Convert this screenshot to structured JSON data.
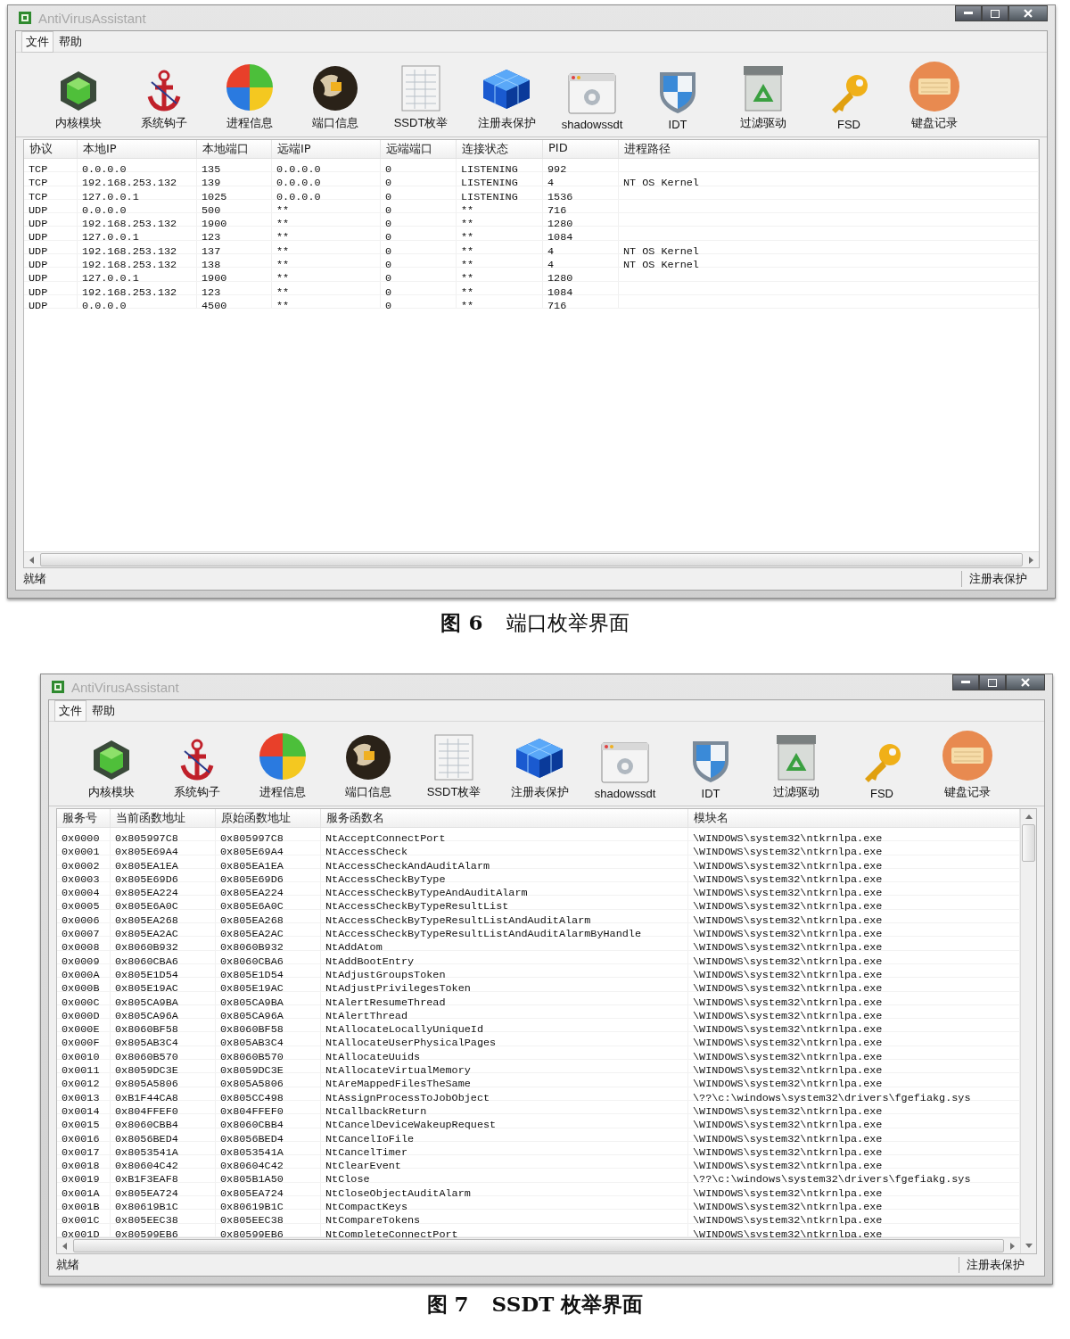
{
  "figures": [
    {
      "window": {
        "title": "AntiVirusAssistant",
        "menu": [
          "文件",
          "帮助"
        ],
        "toolbar": [
          {
            "label": "内核模块"
          },
          {
            "label": "系统钩子"
          },
          {
            "label": "进程信息"
          },
          {
            "label": "端口信息"
          },
          {
            "label": "SSDT枚举"
          },
          {
            "label": "注册表保护"
          },
          {
            "label": "shadowssdt"
          },
          {
            "label": "IDT"
          },
          {
            "label": "过滤驱动"
          },
          {
            "label": "FSD"
          },
          {
            "label": "键盘记录"
          }
        ],
        "table": {
          "vertical_scrollbar": false,
          "columns": [
            "协议",
            "本地IP",
            "本地端口",
            "远端IP",
            "远端端口",
            "连接状态",
            "PID",
            "进程路径"
          ],
          "rows": [
            [
              "TCP",
              "0.0.0.0",
              "135",
              "0.0.0.0",
              "0",
              "LISTENING",
              "992"
            ],
            [
              "TCP",
              "192.168.253.132",
              "139",
              "0.0.0.0",
              "0",
              "LISTENING",
              "4",
              "NT OS Kernel"
            ],
            [
              "TCP",
              "127.0.0.1",
              "1025",
              "0.0.0.0",
              "0",
              "LISTENING",
              "1536"
            ],
            [
              "UDP",
              "0.0.0.0",
              "500",
              "**",
              "0",
              "**",
              "716"
            ],
            [
              "UDP",
              "192.168.253.132",
              "1900",
              "**",
              "0",
              "**",
              "1280"
            ],
            [
              "UDP",
              "127.0.0.1",
              "123",
              "**",
              "0",
              "**",
              "1084"
            ],
            [
              "UDP",
              "192.168.253.132",
              "137",
              "**",
              "0",
              "**",
              "4",
              "NT OS Kernel"
            ],
            [
              "UDP",
              "192.168.253.132",
              "138",
              "**",
              "0",
              "**",
              "4",
              "NT OS Kernel"
            ],
            [
              "UDP",
              "127.0.0.1",
              "1900",
              "**",
              "0",
              "**",
              "1280"
            ],
            [
              "UDP",
              "192.168.253.132",
              "123",
              "**",
              "0",
              "**",
              "1084"
            ],
            [
              "UDP",
              "0.0.0.0",
              "4500",
              "**",
              "0",
              "**",
              "716"
            ]
          ]
        },
        "status_bar": {
          "left": "就绪",
          "right": "注册表保护"
        }
      },
      "caption": {
        "number": "图 6",
        "title": "端口枚举界面"
      }
    },
    {
      "window": {
        "title": "AntiVirusAssistant",
        "menu": [
          "文件",
          "帮助"
        ],
        "toolbar": [
          {
            "label": "内核模块"
          },
          {
            "label": "系统钩子"
          },
          {
            "label": "进程信息"
          },
          {
            "label": "端口信息"
          },
          {
            "label": "SSDT枚举"
          },
          {
            "label": "注册表保护"
          },
          {
            "label": "shadowssdt"
          },
          {
            "label": "IDT"
          },
          {
            "label": "过滤驱动"
          },
          {
            "label": "FSD"
          },
          {
            "label": "键盘记录"
          }
        ],
        "table": {
          "vertical_scrollbar": true,
          "columns": [
            "服务号",
            "当前函数地址",
            "原始函数地址",
            "服务函数名",
            "模块名"
          ],
          "rows": [
            [
              "0x0000",
              "0x805997C8",
              "0x805997C8",
              "NtAcceptConnectPort",
              "\\WINDOWS\\system32\\ntkrnlpa.exe"
            ],
            [
              "0x0001",
              "0x805E69A4",
              "0x805E69A4",
              "NtAccessCheck",
              "\\WINDOWS\\system32\\ntkrnlpa.exe"
            ],
            [
              "0x0002",
              "0x805EA1EA",
              "0x805EA1EA",
              "NtAccessCheckAndAuditAlarm",
              "\\WINDOWS\\system32\\ntkrnlpa.exe"
            ],
            [
              "0x0003",
              "0x805E69D6",
              "0x805E69D6",
              "NtAccessCheckByType",
              "\\WINDOWS\\system32\\ntkrnlpa.exe"
            ],
            [
              "0x0004",
              "0x805EA224",
              "0x805EA224",
              "NtAccessCheckByTypeAndAuditAlarm",
              "\\WINDOWS\\system32\\ntkrnlpa.exe"
            ],
            [
              "0x0005",
              "0x805E6A0C",
              "0x805E6A0C",
              "NtAccessCheckByTypeResultList",
              "\\WINDOWS\\system32\\ntkrnlpa.exe"
            ],
            [
              "0x0006",
              "0x805EA268",
              "0x805EA268",
              "NtAccessCheckByTypeResultListAndAuditAlarm",
              "\\WINDOWS\\system32\\ntkrnlpa.exe"
            ],
            [
              "0x0007",
              "0x805EA2AC",
              "0x805EA2AC",
              "NtAccessCheckByTypeResultListAndAuditAlarmByHandle",
              "\\WINDOWS\\system32\\ntkrnlpa.exe"
            ],
            [
              "0x0008",
              "0x8060B932",
              "0x8060B932",
              "NtAddAtom",
              "\\WINDOWS\\system32\\ntkrnlpa.exe"
            ],
            [
              "0x0009",
              "0x8060CBA6",
              "0x8060CBA6",
              "NtAddBootEntry",
              "\\WINDOWS\\system32\\ntkrnlpa.exe"
            ],
            [
              "0x000A",
              "0x805E1D54",
              "0x805E1D54",
              "NtAdjustGroupsToken",
              "\\WINDOWS\\system32\\ntkrnlpa.exe"
            ],
            [
              "0x000B",
              "0x805E19AC",
              "0x805E19AC",
              "NtAdjustPrivilegesToken",
              "\\WINDOWS\\system32\\ntkrnlpa.exe"
            ],
            [
              "0x000C",
              "0x805CA9BA",
              "0x805CA9BA",
              "NtAlertResumeThread",
              "\\WINDOWS\\system32\\ntkrnlpa.exe"
            ],
            [
              "0x000D",
              "0x805CA96A",
              "0x805CA96A",
              "NtAlertThread",
              "\\WINDOWS\\system32\\ntkrnlpa.exe"
            ],
            [
              "0x000E",
              "0x8060BF58",
              "0x8060BF58",
              "NtAllocateLocallyUniqueId",
              "\\WINDOWS\\system32\\ntkrnlpa.exe"
            ],
            [
              "0x000F",
              "0x805AB3C4",
              "0x805AB3C4",
              "NtAllocateUserPhysicalPages",
              "\\WINDOWS\\system32\\ntkrnlpa.exe"
            ],
            [
              "0x0010",
              "0x8060B570",
              "0x8060B570",
              "NtAllocateUuids",
              "\\WINDOWS\\system32\\ntkrnlpa.exe"
            ],
            [
              "0x0011",
              "0x8059DC3E",
              "0x8059DC3E",
              "NtAllocateVirtualMemory",
              "\\WINDOWS\\system32\\ntkrnlpa.exe"
            ],
            [
              "0x0012",
              "0x805A5806",
              "0x805A5806",
              "NtAreMappedFilesTheSame",
              "\\WINDOWS\\system32\\ntkrnlpa.exe"
            ],
            [
              "0x0013",
              "0xB1F44CA8",
              "0x805CC498",
              "NtAssignProcessToJobObject",
              "\\??\\c:\\windows\\system32\\drivers\\fgefiakg.sys"
            ],
            [
              "0x0014",
              "0x804FFEF0",
              "0x804FFEF0",
              "NtCallbackReturn",
              "\\WINDOWS\\system32\\ntkrnlpa.exe"
            ],
            [
              "0x0015",
              "0x8060CBB4",
              "0x8060CBB4",
              "NtCancelDeviceWakeupRequest",
              "\\WINDOWS\\system32\\ntkrnlpa.exe"
            ],
            [
              "0x0016",
              "0x8056BED4",
              "0x8056BED4",
              "NtCancelIoFile",
              "\\WINDOWS\\system32\\ntkrnlpa.exe"
            ],
            [
              "0x0017",
              "0x8053541A",
              "0x8053541A",
              "NtCancelTimer",
              "\\WINDOWS\\system32\\ntkrnlpa.exe"
            ],
            [
              "0x0018",
              "0x80604C42",
              "0x80604C42",
              "NtClearEvent",
              "\\WINDOWS\\system32\\ntkrnlpa.exe"
            ],
            [
              "0x0019",
              "0xB1F3EAF8",
              "0x805B1A50",
              "NtClose",
              "\\??\\c:\\windows\\system32\\drivers\\fgefiakg.sys"
            ],
            [
              "0x001A",
              "0x805EA724",
              "0x805EA724",
              "NtCloseObjectAuditAlarm",
              "\\WINDOWS\\system32\\ntkrnlpa.exe"
            ],
            [
              "0x001B",
              "0x80619B1C",
              "0x80619B1C",
              "NtCompactKeys",
              "\\WINDOWS\\system32\\ntkrnlpa.exe"
            ],
            [
              "0x001C",
              "0x805EEC38",
              "0x805EEC38",
              "NtCompareTokens",
              "\\WINDOWS\\system32\\ntkrnlpa.exe"
            ],
            [
              "0x001D",
              "0x80599EB6",
              "0x80599EB6",
              "NtCompleteConnectPort",
              "\\WINDOWS\\system32\\ntkrnlpa.exe"
            ]
          ]
        },
        "status_bar": {
          "left": "就绪",
          "right": "注册表保护"
        }
      },
      "caption": {
        "number": "图 7",
        "title": "SSDT 枚举界面"
      }
    }
  ]
}
